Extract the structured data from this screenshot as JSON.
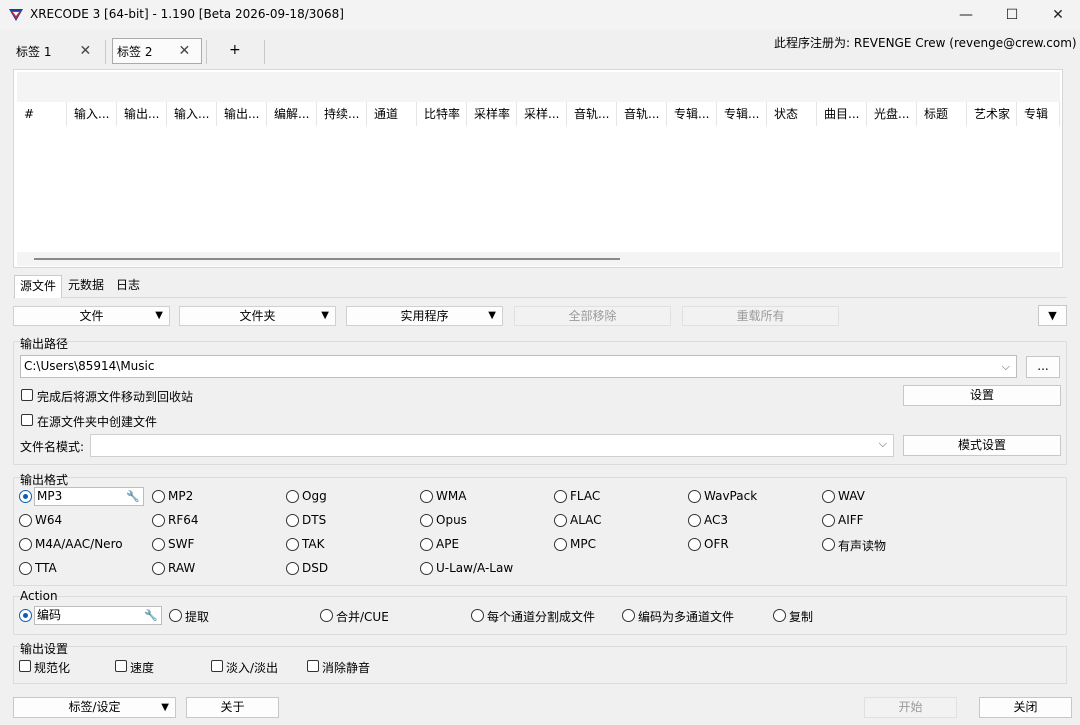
{
  "window": {
    "title": "XRECODE 3 [64-bit] - 1.190 [Beta 2026-09-18/3068]",
    "min_glyph": "—",
    "max_glyph": "☐",
    "close_glyph": "✕"
  },
  "tabs": {
    "items": [
      {
        "label": "标签 1",
        "close": "✕"
      },
      {
        "label": "标签 2",
        "close": "✕"
      }
    ],
    "add_label": "+",
    "registered": "此程序注册为: REVENGE Crew (revenge@crew.com)"
  },
  "file_list": {
    "columns": [
      "#",
      "输入...",
      "输出...",
      "输入...",
      "输出...",
      "编解...",
      "持续...",
      "通道",
      "比特率",
      "采样率",
      "采样...",
      "音轨...",
      "音轨...",
      "专辑...",
      "专辑...",
      "状态",
      "曲目...",
      "光盘...",
      "标题",
      "艺术家",
      "专辑"
    ]
  },
  "lower_tabs": [
    "源文件",
    "元数据",
    "日志"
  ],
  "toolbar": {
    "file": "文件",
    "folder": "文件夹",
    "utilities": "实用程序",
    "remove_all": "全部移除",
    "reload_all": "重载所有",
    "arrow": "▼"
  },
  "output_path": {
    "group_title": "输出路径",
    "path": "C:\\Users\\85914\\Music",
    "browse": "...",
    "move_to_recycle": "完成后将源文件移动到回收站",
    "create_in_source": "在源文件夹中创建文件",
    "settings_button": "设置",
    "pattern_label": "文件名模式:",
    "pattern_value": "",
    "pattern_button": "模式设置",
    "chevron": "⌵"
  },
  "output_format": {
    "group_title": "输出格式",
    "selected": "MP3",
    "rows": [
      [
        "MP3",
        "MP2",
        "Ogg",
        "WMA",
        "FLAC",
        "WavPack",
        "WAV"
      ],
      [
        "W64",
        "RF64",
        "DTS",
        "Opus",
        "ALAC",
        "AC3",
        "AIFF"
      ],
      [
        "M4A/AAC/Nero",
        "SWF",
        "TAK",
        "APE",
        "MPC",
        "OFR",
        "有声读物"
      ],
      [
        "TTA",
        "RAW",
        "DSD",
        "U-Law/A-Law"
      ]
    ]
  },
  "action": {
    "group_title": "Action",
    "options": [
      "编码",
      "提取",
      "合并/CUE",
      "每个通道分割成文件",
      "编码为多通道文件",
      "复制"
    ],
    "selected": "编码"
  },
  "output_settings": {
    "group_title": "输出设置",
    "options": [
      "规范化",
      "速度",
      "淡入/淡出",
      "消除静音"
    ]
  },
  "footer": {
    "tabs_settings": "标签/设定",
    "about": "关于",
    "start": "开始",
    "close": "关闭"
  },
  "icons": {
    "app_logo": "xrecode-logo-icon",
    "wrench": "🔧"
  },
  "colors": {
    "radio_accent": "#0a5fb4",
    "disabled_text": "#9a9a9a"
  }
}
